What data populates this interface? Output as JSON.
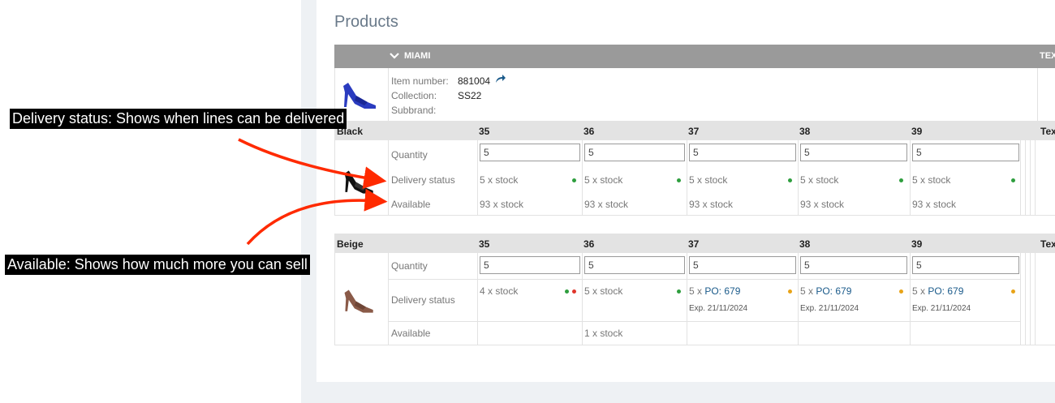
{
  "page_title": "Products",
  "product": {
    "name": "MIAMI",
    "right_header": "TEX",
    "item_number_label": "Item number:",
    "item_number": "881004",
    "collection_label": "Collection:",
    "collection": "SS22",
    "subbrand_label": "Subbrand:"
  },
  "sizes": [
    "35",
    "36",
    "37",
    "38",
    "39"
  ],
  "size_tail": "Tex",
  "row_labels": {
    "quantity": "Quantity",
    "delivery": "Delivery status",
    "available": "Available"
  },
  "variants": [
    {
      "color": "Black",
      "quantity": [
        "5",
        "5",
        "5",
        "5",
        "5"
      ],
      "delivery": [
        "5 x stock",
        "5 x stock",
        "5 x stock",
        "5 x stock",
        "5 x stock"
      ],
      "available": [
        "93 x stock",
        "93 x stock",
        "93 x stock",
        "93 x stock",
        "93 x stock"
      ]
    },
    {
      "color": "Beige",
      "quantity": [
        "5",
        "5",
        "5",
        "5",
        "5"
      ],
      "delivery": [
        {
          "prefix": "4 x stock",
          "link": "",
          "exp": ""
        },
        {
          "prefix": "5 x stock",
          "link": "",
          "exp": ""
        },
        {
          "prefix": "5 x ",
          "link": "PO: 679",
          "exp": "Exp. 21/11/2024"
        },
        {
          "prefix": "5 x ",
          "link": "PO: 679",
          "exp": "Exp. 21/11/2024"
        },
        {
          "prefix": "5 x ",
          "link": "PO: 679",
          "exp": "Exp. 21/11/2024"
        }
      ],
      "available": [
        "",
        "1 x stock",
        "",
        "",
        ""
      ]
    }
  ],
  "colors": {
    "green": "#2e9e3e",
    "red": "#e0352b",
    "orange": "#e8a317",
    "arrow": "#ff2a00"
  },
  "annotations": {
    "delivery": "Delivery status: Shows when lines can be delivered",
    "available": "Available: Shows how much more you can sell"
  }
}
